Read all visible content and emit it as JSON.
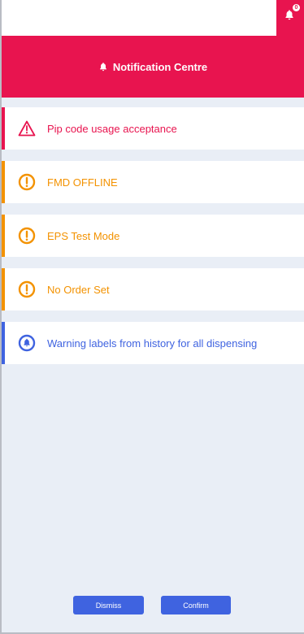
{
  "topbar": {
    "bell_icon": "bell-icon",
    "badge_count": "0"
  },
  "header": {
    "icon": "bell-icon",
    "title": "Notification Centre"
  },
  "notifications": [
    {
      "severity": "error",
      "icon": "warning-triangle-icon",
      "text": "Pip code usage acceptance"
    },
    {
      "severity": "warning",
      "icon": "exclamation-circle-icon",
      "text": "FMD OFFLINE"
    },
    {
      "severity": "warning",
      "icon": "exclamation-circle-icon",
      "text": "EPS Test Mode"
    },
    {
      "severity": "warning",
      "icon": "exclamation-circle-icon",
      "text": "No Order Set"
    },
    {
      "severity": "info",
      "icon": "bell-circle-icon",
      "text": "Warning labels from history for all dispensing"
    }
  ],
  "actions": {
    "dismiss_label": "Dismiss",
    "confirm_label": "Confirm"
  },
  "colors": {
    "accent": "#e8144f",
    "warning": "#f39200",
    "info": "#3f63e0",
    "background": "#e9eef6"
  }
}
